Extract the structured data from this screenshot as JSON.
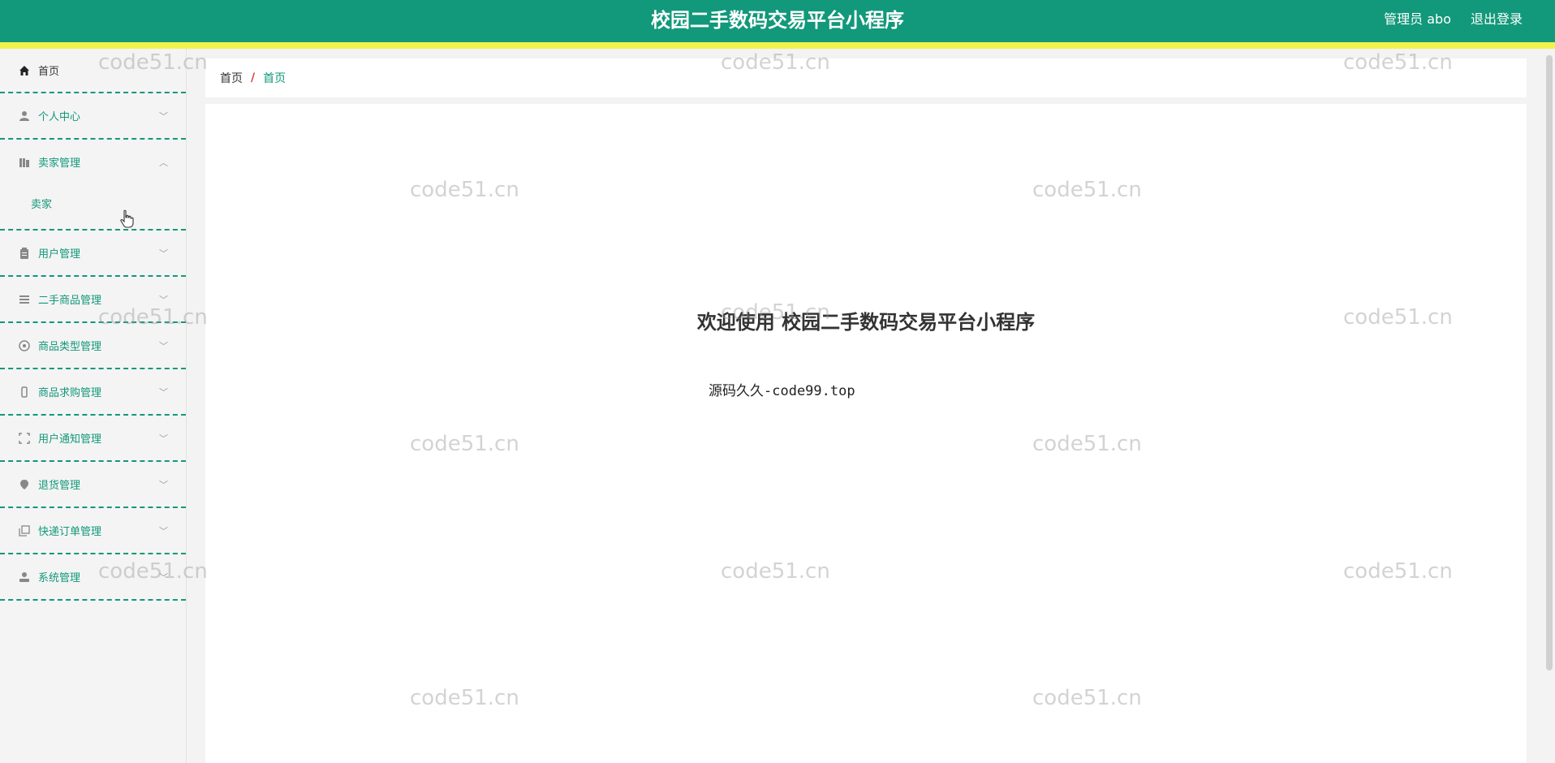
{
  "header": {
    "title": "校园二手数码交易平台小程序",
    "user_label": "管理员 abo",
    "logout_label": "退出登录"
  },
  "sidebar": {
    "items": [
      {
        "label": "首页",
        "icon": "home-icon"
      },
      {
        "label": "个人中心",
        "icon": "user-icon"
      },
      {
        "label": "卖家管理",
        "icon": "library-icon",
        "expanded": true,
        "children": [
          "卖家"
        ]
      },
      {
        "label": "用户管理",
        "icon": "clipboard-icon"
      },
      {
        "label": "二手商品管理",
        "icon": "list-icon"
      },
      {
        "label": "商品类型管理",
        "icon": "aperture-icon"
      },
      {
        "label": "商品求购管理",
        "icon": "phone-icon"
      },
      {
        "label": "用户通知管理",
        "icon": "fullscreen-icon"
      },
      {
        "label": "退货管理",
        "icon": "location-icon"
      },
      {
        "label": "快递订单管理",
        "icon": "copy-icon"
      },
      {
        "label": "系统管理",
        "icon": "admin-icon"
      }
    ]
  },
  "breadcrumb": {
    "home": "首页",
    "separator": "/",
    "current": "首页"
  },
  "main": {
    "welcome": "欢迎使用 校园二手数码交易平台小程序",
    "credit": "源码久久-code99.top"
  },
  "watermark": "code51.cn",
  "colors": {
    "primary": "#12987a",
    "accent_bar": "#f2f24c",
    "breadcrumb_sep": "#e4393c"
  }
}
